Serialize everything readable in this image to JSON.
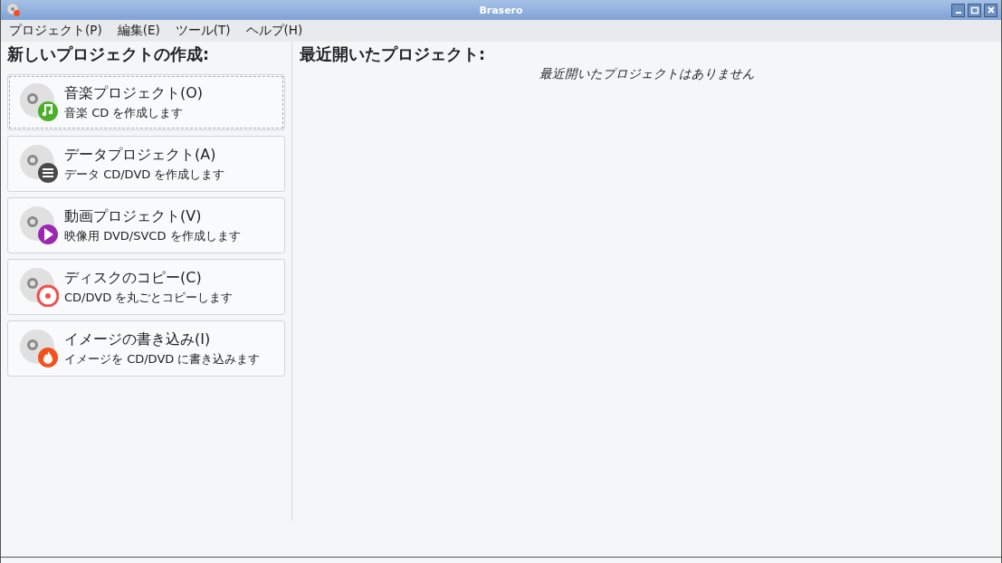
{
  "window": {
    "title": "Brasero"
  },
  "menu": [
    "プロジェクト(P)",
    "編集(E)",
    "ツール(T)",
    "ヘルプ(H)"
  ],
  "new_project": {
    "heading": "新しいプロジェクトの作成:",
    "items": [
      {
        "kind": "music",
        "title": "音楽プロジェクト(O)",
        "subtitle": "音楽 CD を作成します",
        "focused": true
      },
      {
        "kind": "data",
        "title": "データプロジェクト(A)",
        "subtitle": "データ CD/DVD を作成します",
        "focused": false
      },
      {
        "kind": "video",
        "title": "動画プロジェクト(V)",
        "subtitle": "映像用 DVD/SVCD を作成します",
        "focused": false
      },
      {
        "kind": "copy",
        "title": "ディスクのコピー(C)",
        "subtitle": "CD/DVD を丸ごとコピーします",
        "focused": false
      },
      {
        "kind": "image",
        "title": "イメージの書き込み(I)",
        "subtitle": "イメージを CD/DVD に書き込みます",
        "focused": false
      }
    ]
  },
  "recent": {
    "heading": "最近開いたプロジェクト:",
    "empty_message": "最近開いたプロジェクトはありません"
  }
}
